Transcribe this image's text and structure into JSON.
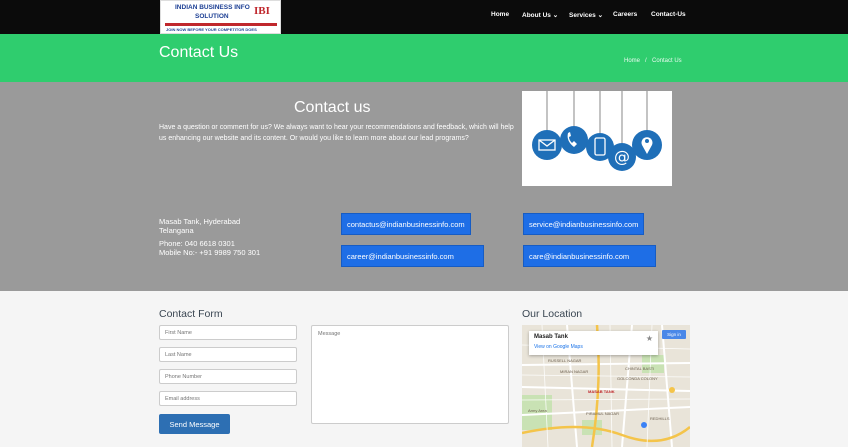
{
  "logo": {
    "line1": "INDIAN BUSINESS INFO",
    "line2": "SOLUTION",
    "mark": "IBI",
    "tagline": "JOIN NOW BEFORE YOUR COMPETITOR DOES"
  },
  "nav": {
    "home": "Home",
    "about": "About Us",
    "services": "Services",
    "careers": "Careers",
    "contact": "Contact-Us"
  },
  "header": {
    "title": "Contact Us",
    "breadcrumb_home": "Home",
    "breadcrumb_sep": "/",
    "breadcrumb_current": "Contact Us"
  },
  "contact": {
    "heading": "Contact us",
    "intro": "Have a question or comment for us? We always want to hear your recommendations and feedback, which will help us enhancing our website and its content.  Or would you like to learn more about our lead programs?",
    "address_line1": "Masab Tank, Hyderabad",
    "address_line2": "Telangana",
    "phone": "Phone: 040 6618 0301",
    "mobile": "Mobile No:- +91 9989 750 301",
    "emails": [
      "contactus@indianbusinessinfo.com",
      "service@indianbusinessinfo.com",
      "career@indianbusinessinfo.com",
      "care@indianbusinessinfo.com"
    ]
  },
  "form": {
    "heading": "Contact Form",
    "first_name": "First Name",
    "last_name": "Last Name",
    "phone": "Phone Number",
    "email": "Email address",
    "message": "Message",
    "send": "Send Message"
  },
  "location": {
    "heading": "Our Location",
    "place": "Masab Tank",
    "view_link": "View on Google Maps",
    "sign_in": "Sign in",
    "labels": [
      "RUSSELL NAGAR",
      "MIRAN NAGAR",
      "CHINTAL BASTI",
      "GOLCONDA COLONY",
      "MASAB TANK",
      "Army Area",
      "PIRAMUL NAGAR",
      "REDHILLS"
    ]
  },
  "colors": {
    "topbar": "#0b0b0b",
    "green": "#2fcd6e",
    "gray": "#9a9a9a",
    "email_button": "#1e6ee6",
    "send_button": "#2d6fb3"
  }
}
